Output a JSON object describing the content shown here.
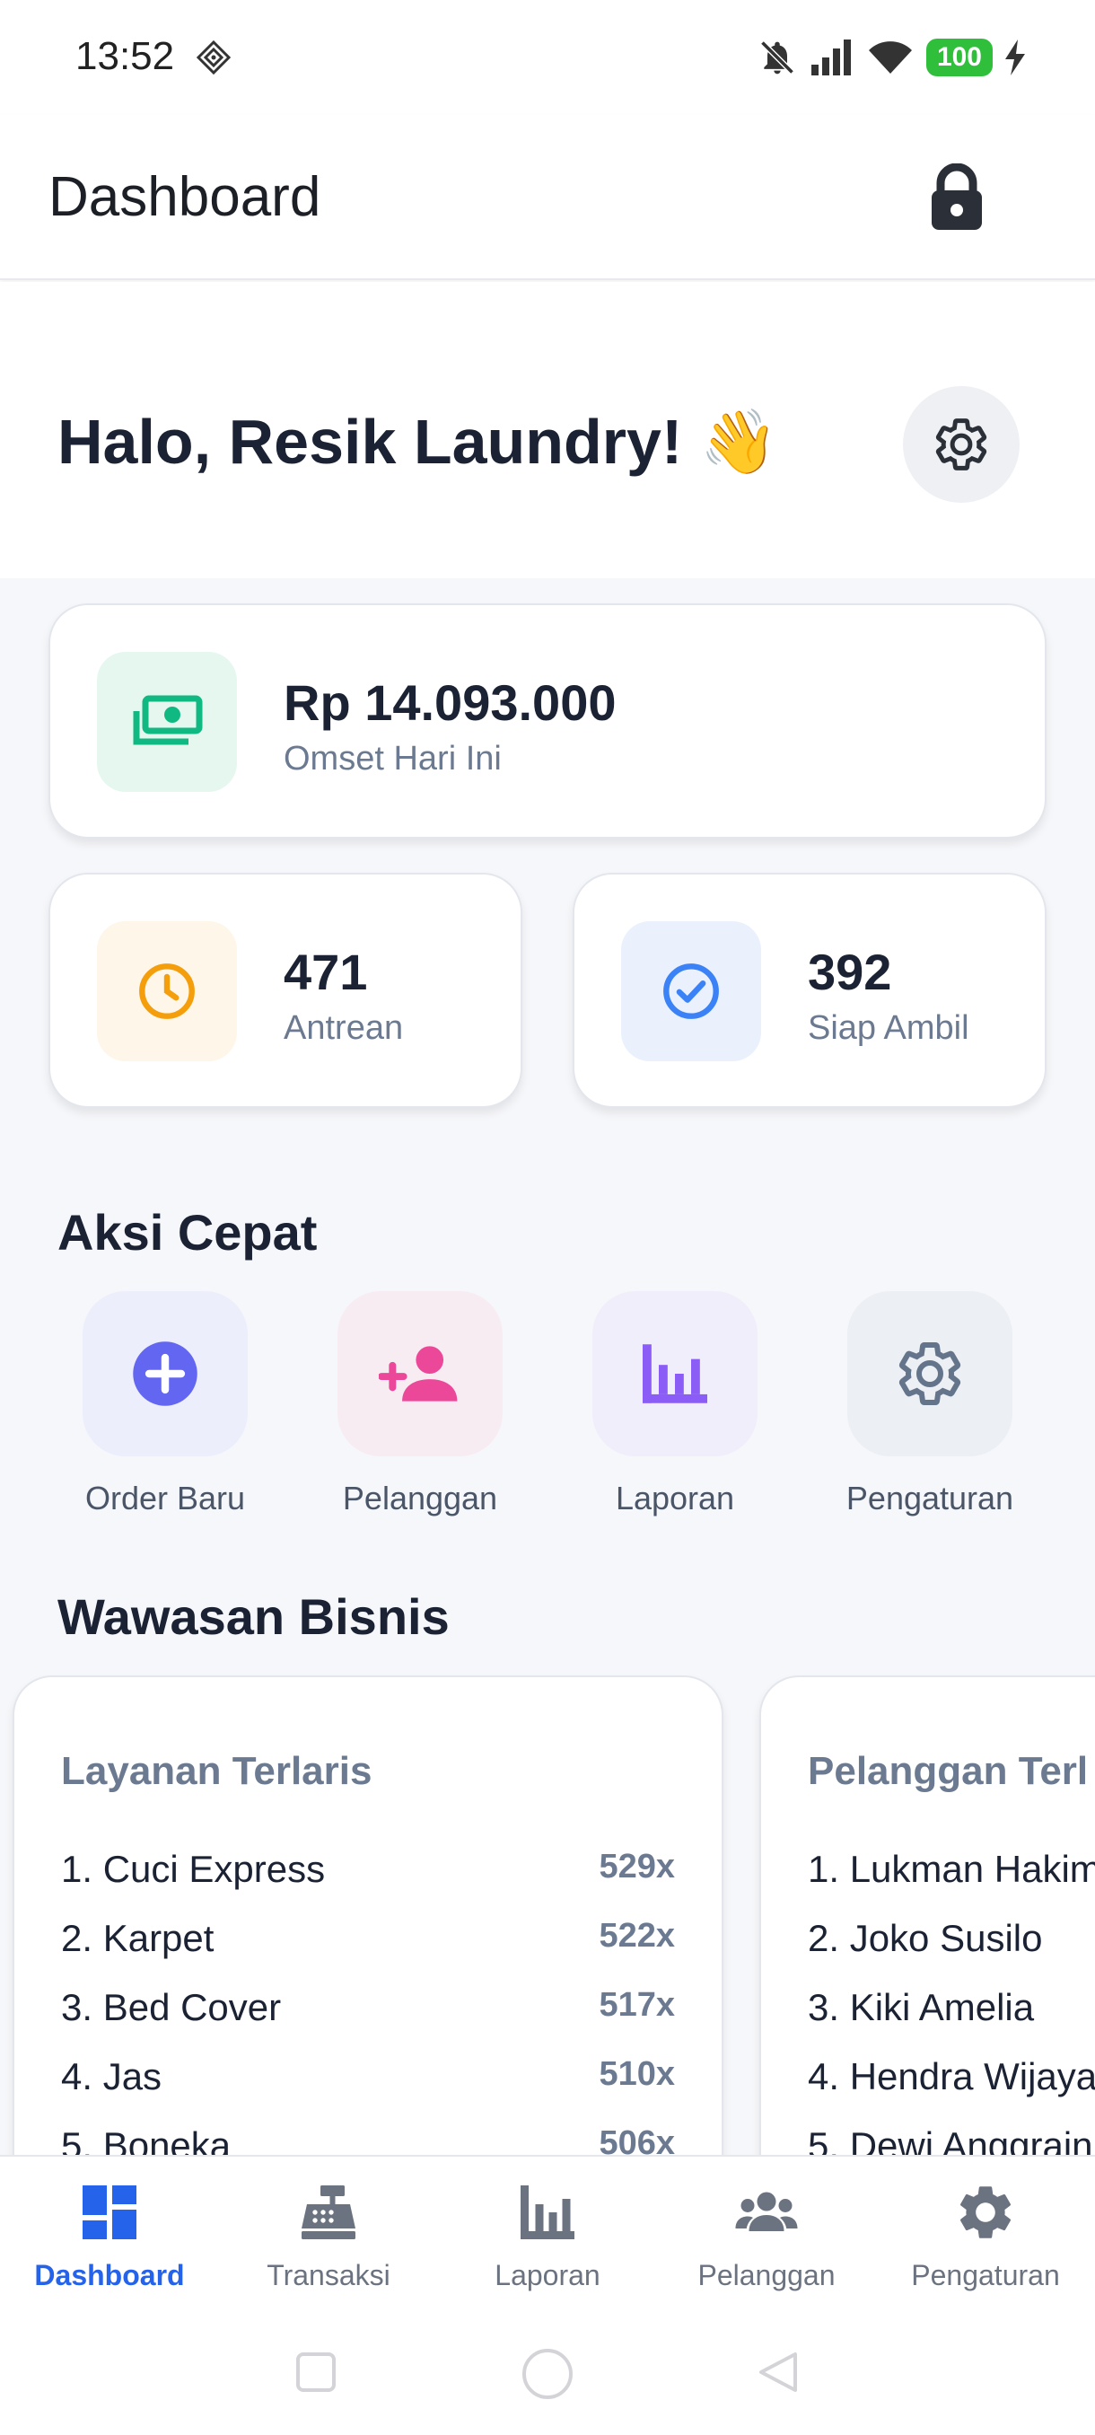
{
  "status_bar": {
    "time": "13:52",
    "battery": "100"
  },
  "app_bar": {
    "title": "Dashboard"
  },
  "greeting": {
    "text": "Halo, Resik Laundry! 👋"
  },
  "stats": {
    "omset": {
      "value": "Rp 14.093.000",
      "label": "Omset Hari Ini",
      "icon": "money-icon",
      "color": "#10b981"
    },
    "antrean": {
      "value": "471",
      "label": "Antrean",
      "icon": "clock-icon",
      "color": "#f59e0b"
    },
    "siap_ambil": {
      "value": "392",
      "label": "Siap Ambil",
      "icon": "check-circle-icon",
      "color": "#3b82f6"
    }
  },
  "quick_actions": {
    "title": "Aksi Cepat",
    "items": [
      {
        "label": "Order Baru",
        "icon": "plus-circle-icon",
        "color": "#6366f1"
      },
      {
        "label": "Pelanggan",
        "icon": "person-add-icon",
        "color": "#ec4899"
      },
      {
        "label": "Laporan",
        "icon": "bar-chart-icon",
        "color": "#8b5cf6"
      },
      {
        "label": "Pengaturan",
        "icon": "gear-icon",
        "color": "#64748b"
      }
    ]
  },
  "insights": {
    "title": "Wawasan Bisnis",
    "cards": [
      {
        "title": "Layanan Terlaris",
        "rows": [
          {
            "name": "1. Cuci Express",
            "count": "529x"
          },
          {
            "name": "2. Karpet",
            "count": "522x"
          },
          {
            "name": "3. Bed Cover",
            "count": "517x"
          },
          {
            "name": "4. Jas",
            "count": "510x"
          },
          {
            "name": "5. Boneka",
            "count": "506x"
          }
        ]
      },
      {
        "title": "Pelanggan Terl",
        "rows": [
          {
            "name": "1. Lukman Hakim"
          },
          {
            "name": "2. Joko Susilo"
          },
          {
            "name": "3. Kiki Amelia"
          },
          {
            "name": "4. Hendra Wijaya"
          },
          {
            "name": "5. Dewi Anggrain"
          }
        ]
      }
    ]
  },
  "bottom_nav": {
    "items": [
      {
        "label": "Dashboard",
        "icon": "dashboard-icon",
        "active": true
      },
      {
        "label": "Transaksi",
        "icon": "cash-register-icon"
      },
      {
        "label": "Laporan",
        "icon": "bar-chart-icon"
      },
      {
        "label": "Pelanggan",
        "icon": "people-icon"
      },
      {
        "label": "Pengaturan",
        "icon": "gear-icon"
      }
    ]
  },
  "colors": {
    "accent": "#2563eb",
    "text_dark": "#1a2233",
    "text_muted": "#6b7a90"
  }
}
